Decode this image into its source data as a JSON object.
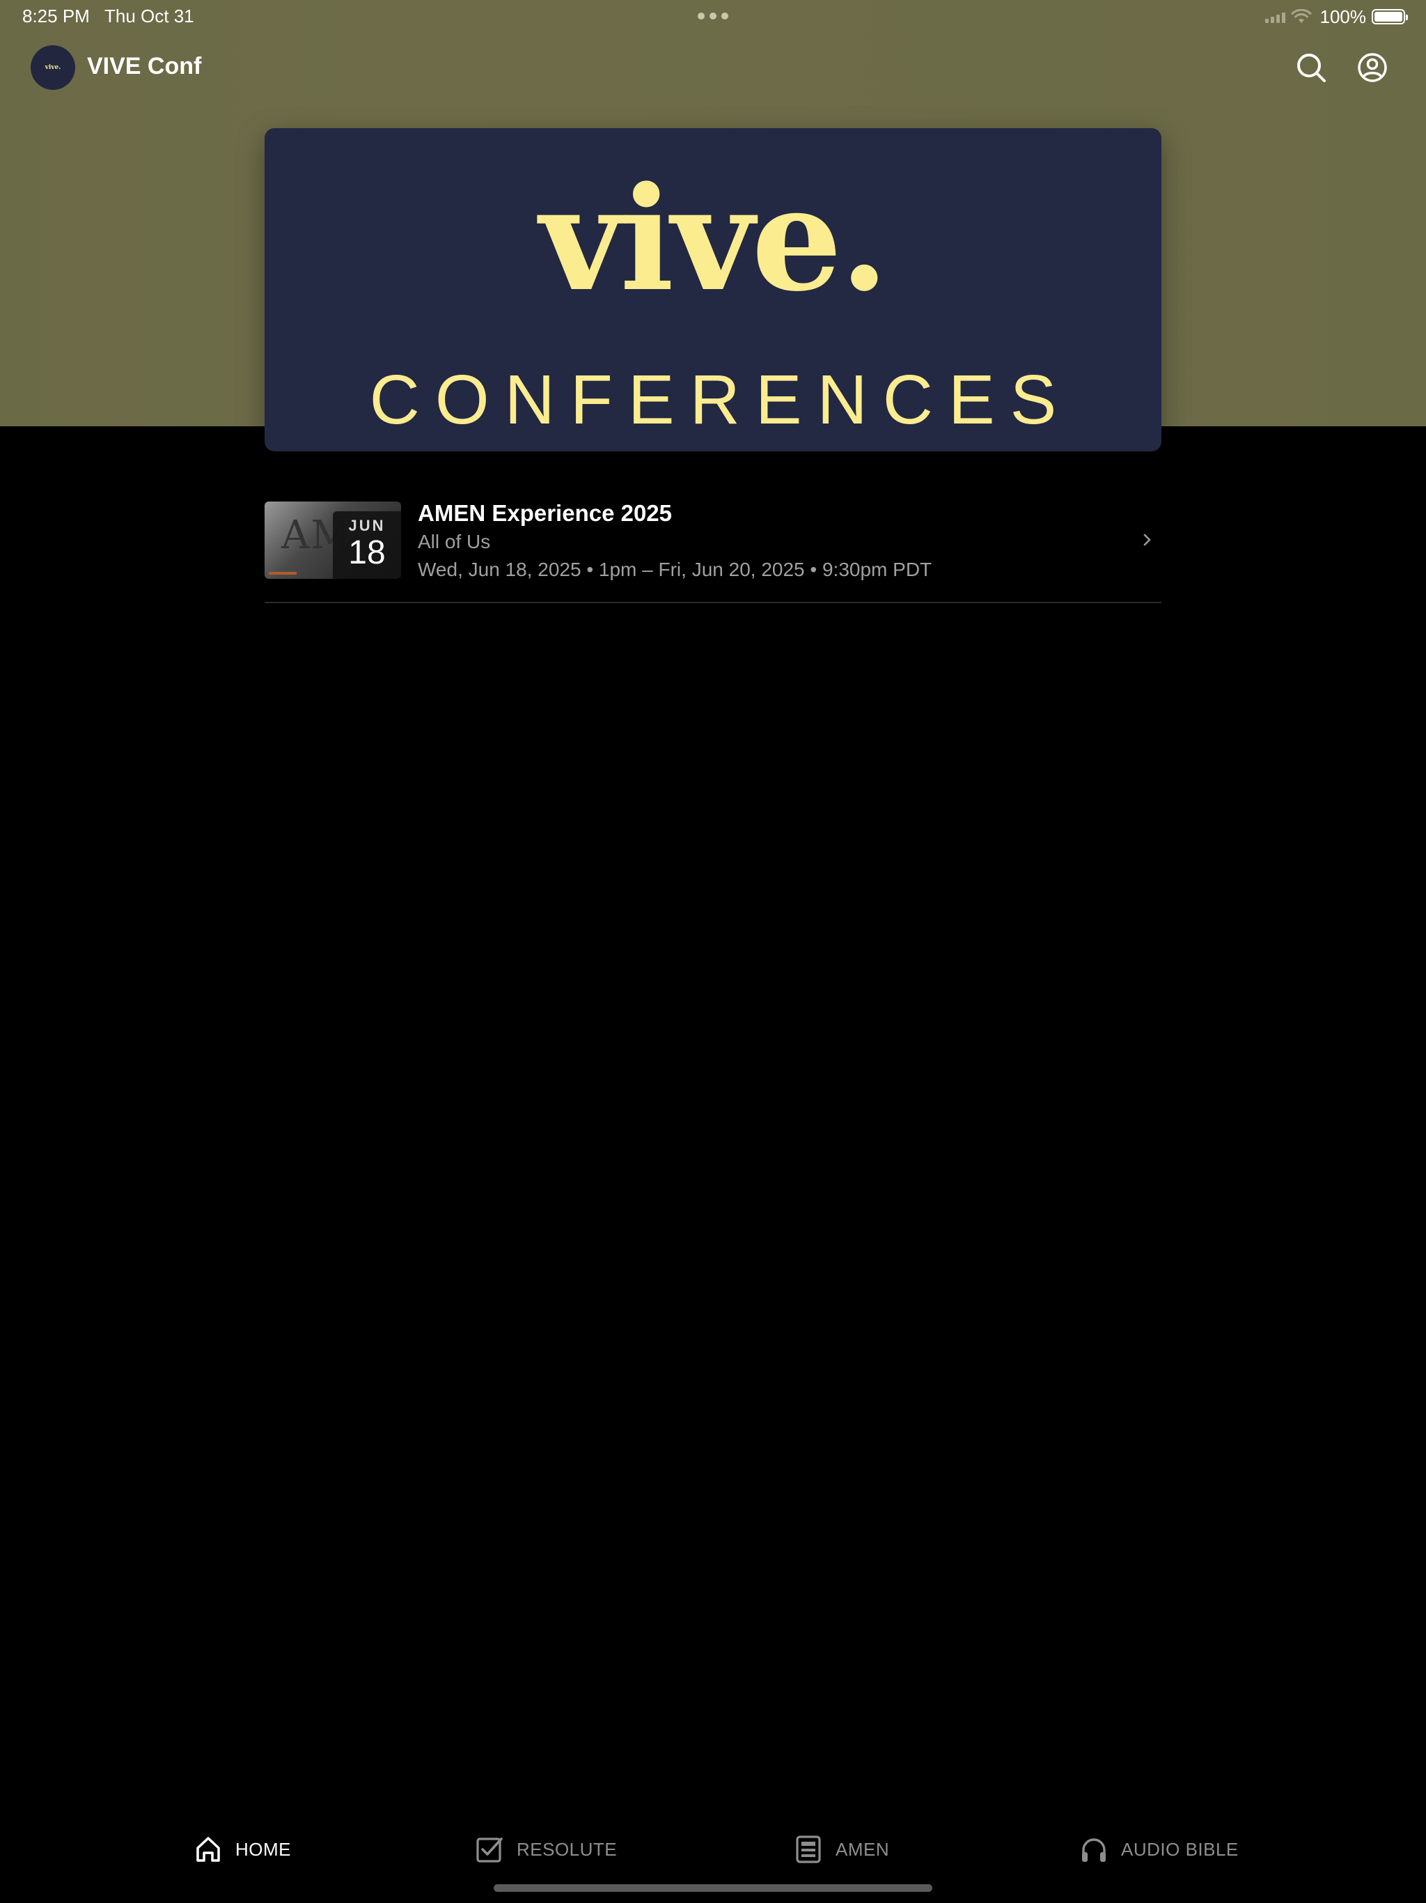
{
  "status_bar": {
    "time": "8:25 PM",
    "date": "Thu Oct 31",
    "battery": "100%"
  },
  "app_bar": {
    "avatar_text": "vive.",
    "title": "VIVE Conf",
    "search_icon": "search-icon",
    "account_icon": "account-circle-icon"
  },
  "banner": {
    "logo": "vive.",
    "subtitle": "CONFERENCES",
    "background": "#232843",
    "text_color": "#fcec90"
  },
  "events": [
    {
      "title": "AMEN Experience 2025",
      "subtitle": "All of Us",
      "when": "Wed, Jun 18, 2025 • 1pm – Fri, Jun 20, 2025 • 9:30pm PDT",
      "badge_month": "JUN",
      "badge_day": "18",
      "thumbnail_text": "AMEN"
    }
  ],
  "tabs": [
    {
      "label": "HOME",
      "icon": "home-icon",
      "active": true
    },
    {
      "label": "RESOLUTE",
      "icon": "checkbox-icon",
      "active": false
    },
    {
      "label": "AMEN",
      "icon": "document-icon",
      "active": false
    },
    {
      "label": "AUDIO BIBLE",
      "icon": "headphones-icon",
      "active": false
    }
  ],
  "colors": {
    "header_band": "#6b6a47",
    "page_background": "#000000",
    "secondary_text": "#a0a0a0"
  }
}
